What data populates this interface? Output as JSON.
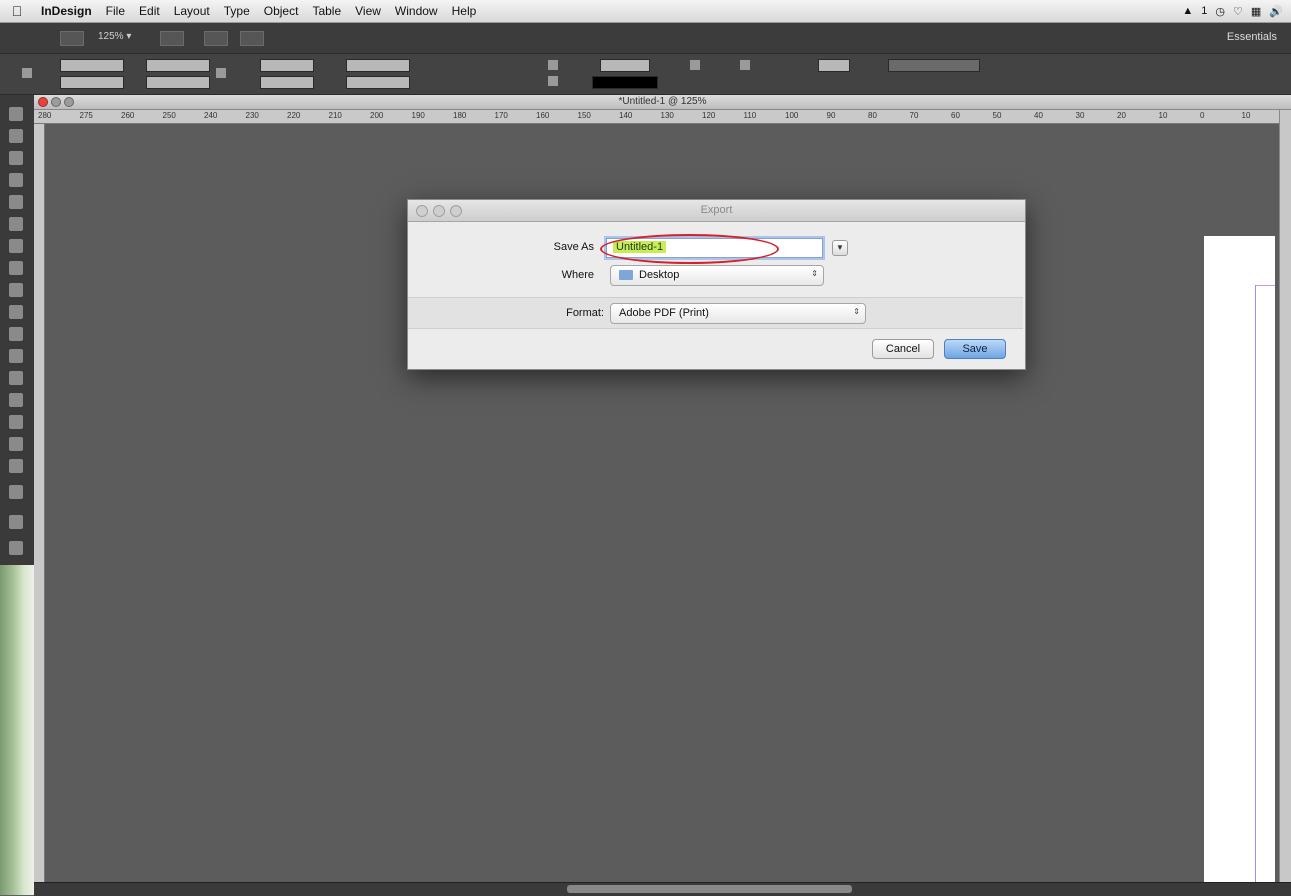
{
  "menubar": {
    "app_name": "InDesign",
    "items": [
      "File",
      "Edit",
      "Layout",
      "Type",
      "Object",
      "Table",
      "View",
      "Window",
      "Help"
    ],
    "status_badge": "1"
  },
  "app_bar": {
    "zoom": "125% ▾",
    "workspace": "Essentials"
  },
  "document": {
    "title": "*Untitled-1 @ 125%"
  },
  "ruler_ticks": [
    "280",
    "275",
    "260",
    "250",
    "240",
    "230",
    "220",
    "210",
    "200",
    "190",
    "180",
    "170",
    "160",
    "150",
    "140",
    "130",
    "120",
    "110",
    "100",
    "90",
    "80",
    "70",
    "60",
    "50",
    "40",
    "30",
    "20",
    "10",
    "0",
    "10"
  ],
  "export_dialog": {
    "title": "Export",
    "save_as_label": "Save As",
    "save_as_value": "Untitled-1",
    "where_label": "Where",
    "where_value": "Desktop",
    "format_label": "Format:",
    "format_value": "Adobe PDF (Print)",
    "cancel_label": "Cancel",
    "save_label": "Save"
  }
}
